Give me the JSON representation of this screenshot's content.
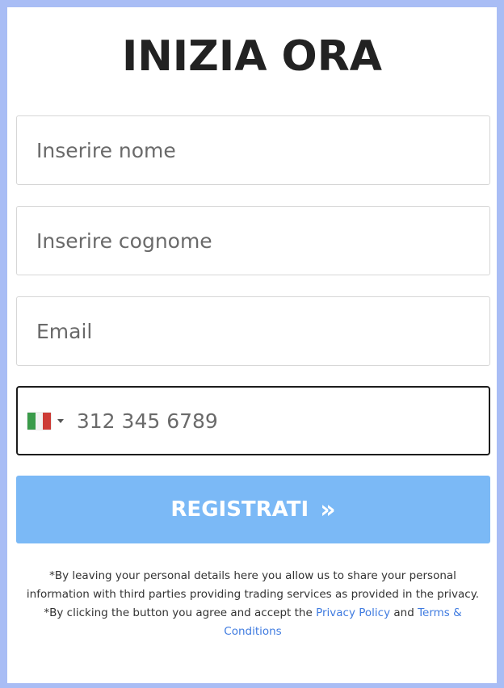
{
  "colors": {
    "frame_border": "#a9bdf5",
    "button_bg": "#7bb9f6",
    "button_text": "#ffffff",
    "title": "#222222",
    "link": "#3f7be0",
    "phone_border": "#1c1c1c"
  },
  "form": {
    "title": "INIZIA ORA",
    "first_name": {
      "placeholder": "Inserire nome",
      "value": ""
    },
    "last_name": {
      "placeholder": "Inserire cognome",
      "value": ""
    },
    "email": {
      "placeholder": "Email",
      "value": ""
    },
    "phone": {
      "country_flag_icon": "italy-flag-icon",
      "country_flag_colors": [
        "#3a9b4a",
        "#f2f2f2",
        "#cd3b36"
      ],
      "placeholder": "312 345 6789",
      "value": ""
    },
    "submit_label": "REGISTRATI",
    "submit_arrows": "»"
  },
  "disclaimer": {
    "line1": "*By leaving your personal details here you allow us to share your personal information with third parties providing trading services as provided in the privacy.",
    "line2_prefix": "*By clicking the button you agree and accept the ",
    "privacy_link": "Privacy Policy",
    "and_text": " and ",
    "terms_link": "Terms & Conditions"
  }
}
